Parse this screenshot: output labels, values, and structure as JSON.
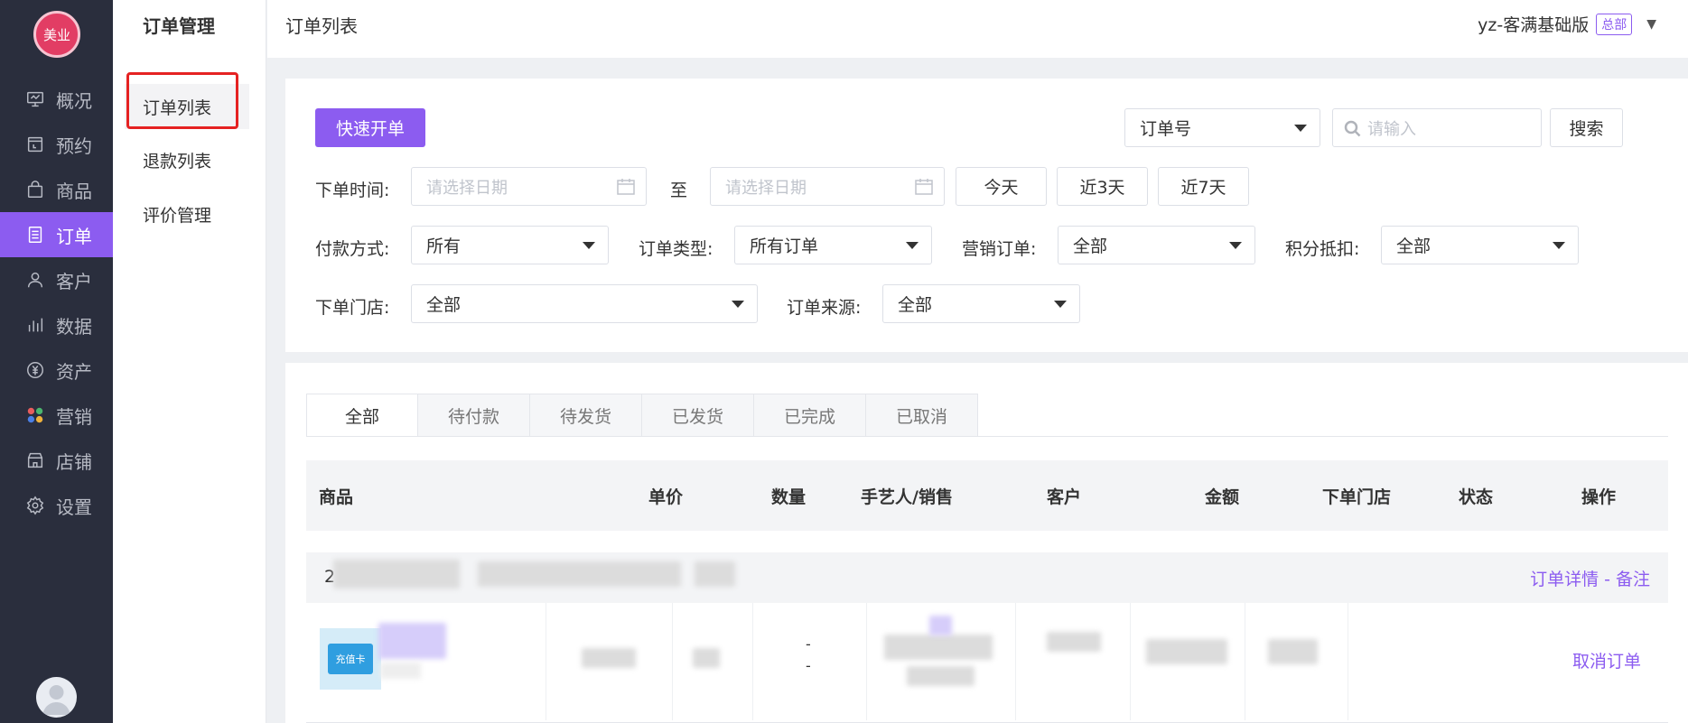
{
  "app": {
    "logo_text": "美业"
  },
  "nav": {
    "items": [
      {
        "label": "概况",
        "icon": "monitor-icon"
      },
      {
        "label": "预约",
        "icon": "calendar-icon"
      },
      {
        "label": "商品",
        "icon": "bag-icon"
      },
      {
        "label": "订单",
        "icon": "list-icon"
      },
      {
        "label": "客户",
        "icon": "user-icon"
      },
      {
        "label": "数据",
        "icon": "bar-chart-icon"
      },
      {
        "label": "资产",
        "icon": "yen-icon"
      },
      {
        "label": "营销",
        "icon": "apps-icon"
      },
      {
        "label": "店铺",
        "icon": "store-icon"
      },
      {
        "label": "设置",
        "icon": "gear-icon"
      }
    ],
    "active_index": 3
  },
  "submenu": {
    "title": "订单管理",
    "items": [
      "订单列表",
      "退款列表",
      "评价管理"
    ]
  },
  "topbar": {
    "page_title": "订单列表",
    "account_name": "yz-客满基础版",
    "account_badge": "总部"
  },
  "filters": {
    "quick_order_label": "快速开单",
    "search_type": "订单号",
    "search_placeholder": "请输入",
    "search_label": "搜索",
    "order_time_label": "下单时间:",
    "date_placeholder": "请选择日期",
    "to_label": "至",
    "today_label": "今天",
    "last3_label": "近3天",
    "last7_label": "近7天",
    "payment_label": "付款方式:",
    "payment_value": "所有",
    "order_type_label": "订单类型:",
    "order_type_value": "所有订单",
    "marketing_label": "营销订单:",
    "marketing_value": "全部",
    "points_label": "积分抵扣:",
    "points_value": "全部",
    "store_label": "下单门店:",
    "store_value": "全部",
    "source_label": "订单来源:",
    "source_value": "全部"
  },
  "tabs": [
    "全部",
    "待付款",
    "待发货",
    "已发货",
    "已完成",
    "已取消"
  ],
  "table": {
    "headers": {
      "product": "商品",
      "price": "单价",
      "qty": "数量",
      "staff": "手艺人/销售",
      "customer": "客户",
      "amount": "金额",
      "store": "下单门店",
      "status": "状态",
      "action": "操作"
    }
  },
  "order": {
    "id_prefix": "2",
    "detail_link": "订单详情 - 备注",
    "card_label": "充值卡",
    "staff_dash1": "-",
    "staff_dash2": "-",
    "cancel_label": "取消订单"
  },
  "colors": {
    "accent": "#8c5cf0",
    "nav_bg": "#2a2e3d",
    "highlight": "#e52222"
  }
}
